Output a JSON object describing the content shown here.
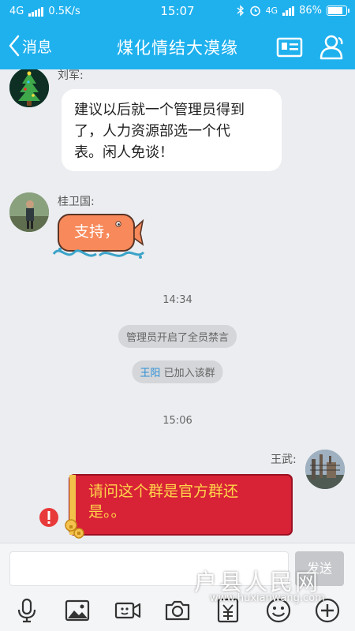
{
  "status_bar": {
    "network": "4G",
    "speed": "0.5K/s",
    "time": "15:07",
    "network_right": "4G",
    "battery": "86%",
    "battery_level": 0.86
  },
  "header": {
    "back_label": "消息",
    "title": "煤化情结大漠缘"
  },
  "messages": {
    "m1": {
      "sender": "刘军:",
      "lines": [
        "建议以后就一个管理员得到",
        "了，人力资源部选一个代",
        "表。闲人免谈！"
      ]
    },
    "m2": {
      "sender": "桂卫国:",
      "text": "支持，"
    },
    "time1": "14:34",
    "sys1": "管理员开启了全员禁言",
    "sys2": {
      "name": "王阳",
      "text": " 已加入该群"
    },
    "time2": "15:06",
    "m3": {
      "sender": "王武:",
      "lines": [
        "请问这个群是官方群还",
        "是。。"
      ]
    }
  },
  "input": {
    "value": "",
    "send_label": "发送"
  },
  "watermark": {
    "title": "户县人民网",
    "url": "www.huxianwang.com"
  },
  "colors": {
    "accent": "#1fb1ee",
    "error": "#e83a3a",
    "my_bubble": "#d82236"
  }
}
